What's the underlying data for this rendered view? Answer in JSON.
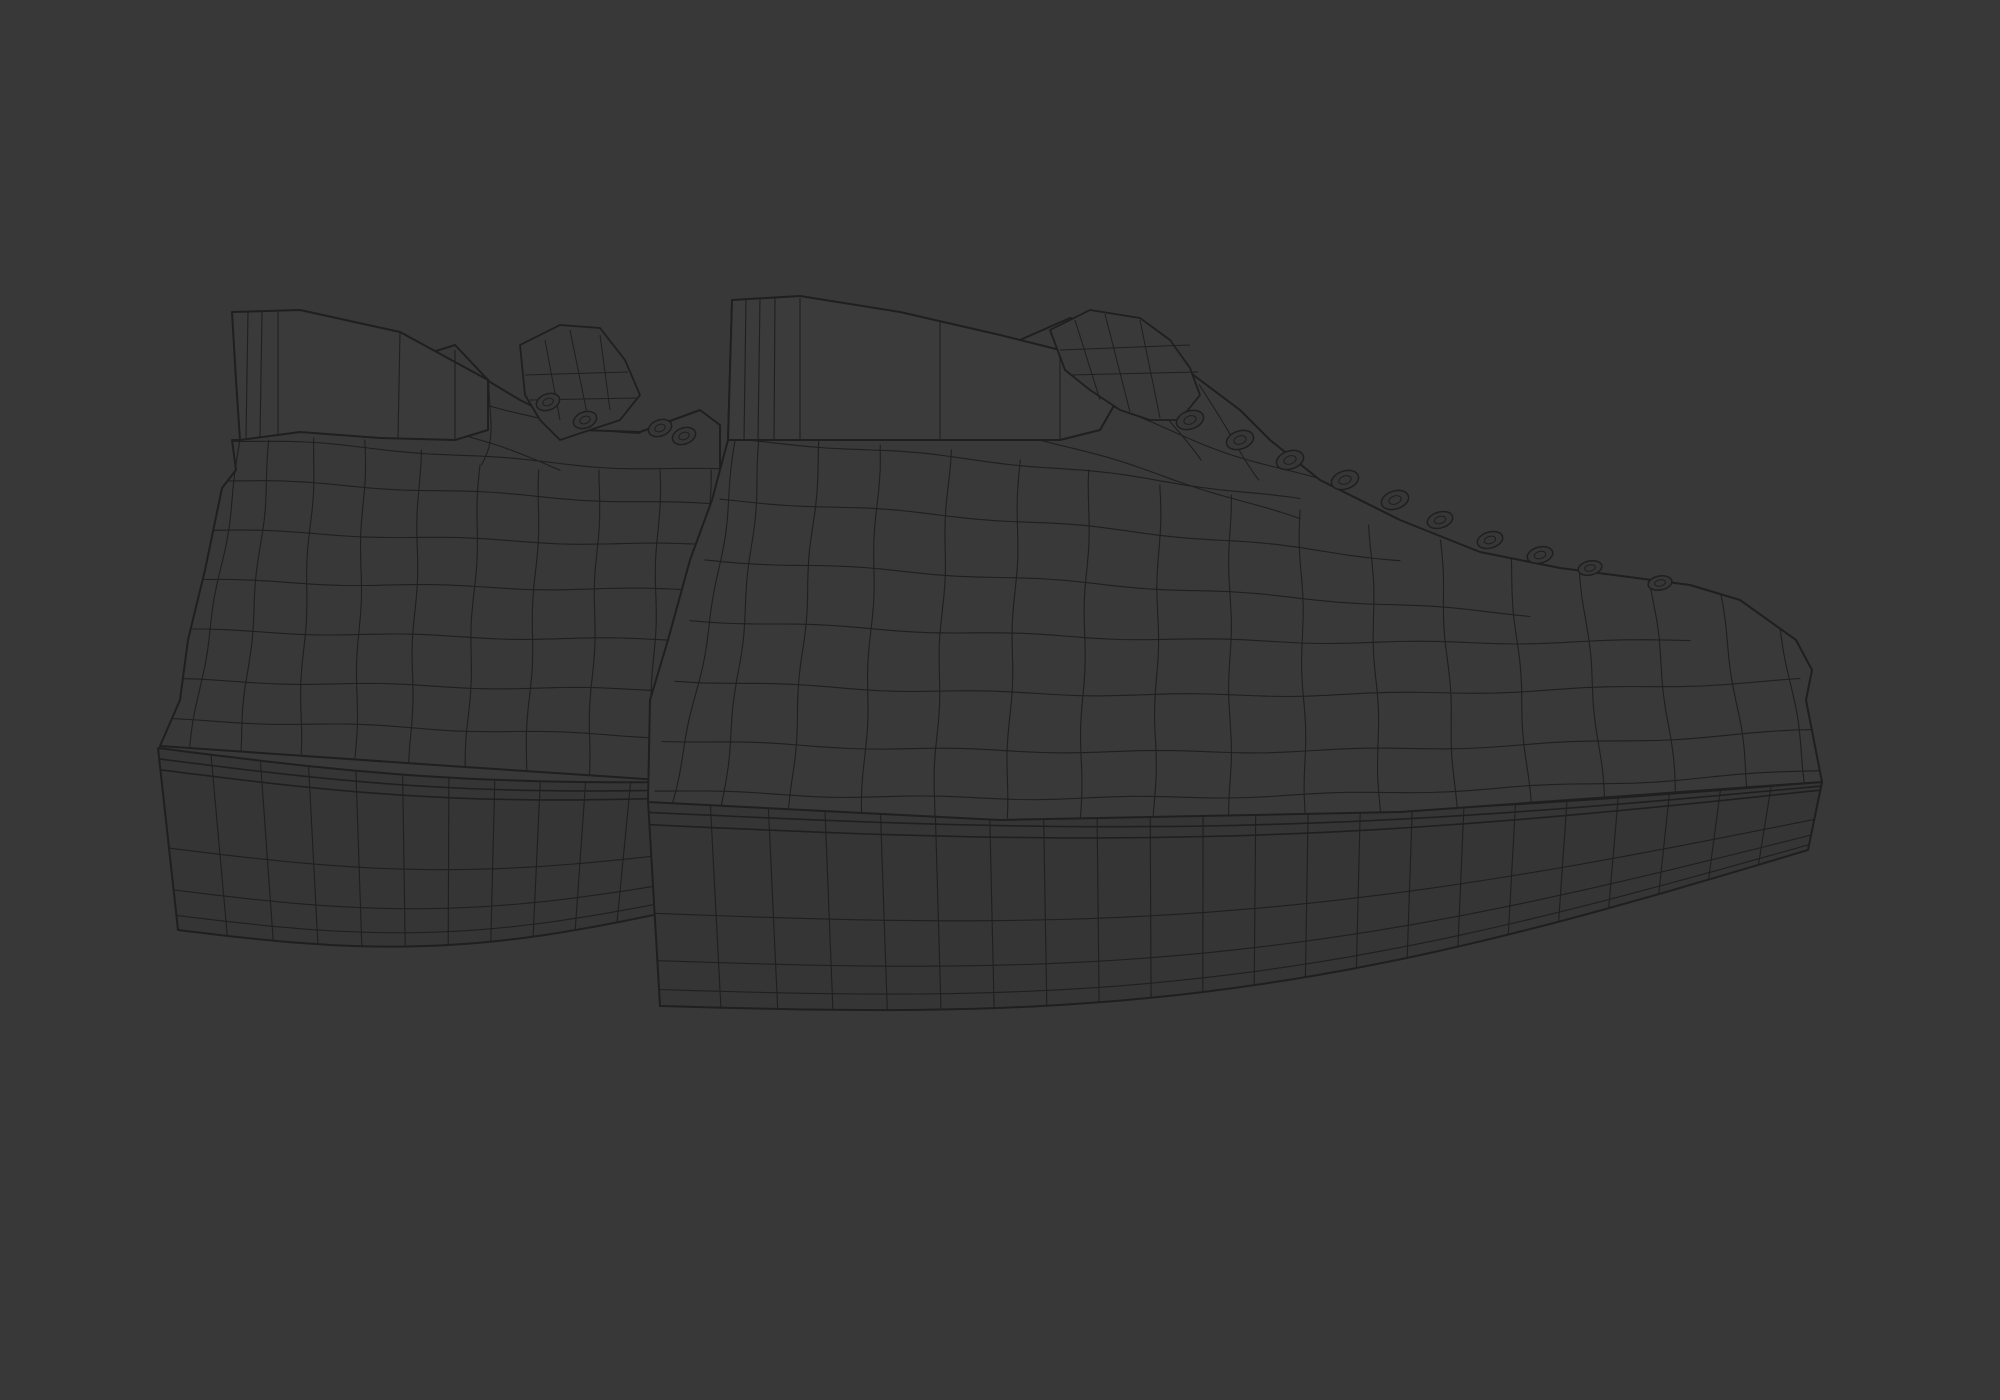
{
  "viewport": {
    "background": "#383838",
    "wire_color": "#1f1f1f",
    "object_name": "sneakers-pair-wireframe"
  }
}
